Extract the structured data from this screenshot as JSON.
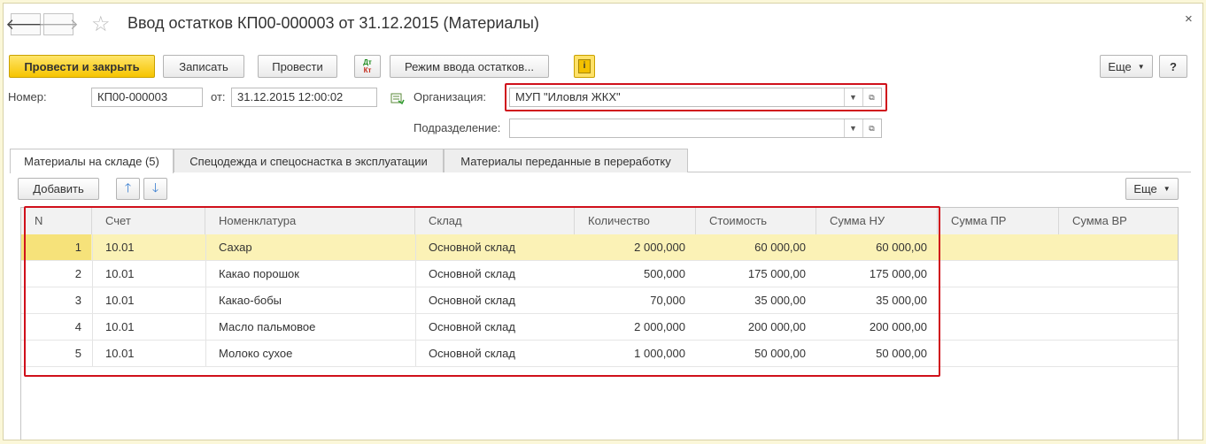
{
  "window": {
    "title": "Ввод остатков КП00-000003 от 31.12.2015 (Материалы)",
    "back_glyph": "🡐",
    "forward_glyph": "🡒",
    "close_glyph": "×",
    "star_glyph": "☆"
  },
  "toolbar": {
    "post_close": "Провести и закрыть",
    "save": "Записать",
    "post": "Провести",
    "dt_label": "Дт",
    "kt_label": "Кт",
    "mode": "Режим ввода остатков...",
    "info_glyph": "i",
    "more": "Еще",
    "help": "?"
  },
  "form": {
    "number_label": "Номер:",
    "number_value": "КП00-000003",
    "date_label": "от:",
    "date_value": "31.12.2015 12:00:02",
    "org_label": "Организация:",
    "org_value": "МУП \"Иловля ЖКХ\"",
    "dept_label": "Подразделение:",
    "dept_value": ""
  },
  "tabs": [
    {
      "label": "Материалы на складе (5)",
      "active": true
    },
    {
      "label": "Спецодежда и спецоснастка в эксплуатации",
      "active": false
    },
    {
      "label": "Материалы переданные в переработку",
      "active": false
    }
  ],
  "table_toolbar": {
    "add": "Добавить",
    "up_glyph": "🡑",
    "down_glyph": "🡓",
    "more": "Еще"
  },
  "table": {
    "columns": [
      "N",
      "Счет",
      "Номенклатура",
      "Склад",
      "Количество",
      "Стоимость",
      "Сумма НУ",
      "Сумма ПР",
      "Сумма ВР"
    ],
    "rows": [
      {
        "n": "1",
        "account": "10.01",
        "item": "Сахар",
        "warehouse": "Основной склад",
        "qty": "2 000,000",
        "cost": "60 000,00",
        "sum_nu": "60 000,00",
        "sum_pr": "",
        "sum_vr": ""
      },
      {
        "n": "2",
        "account": "10.01",
        "item": "Какао порошок",
        "warehouse": "Основной склад",
        "qty": "500,000",
        "cost": "175 000,00",
        "sum_nu": "175 000,00",
        "sum_pr": "",
        "sum_vr": ""
      },
      {
        "n": "3",
        "account": "10.01",
        "item": "Какао-бобы",
        "warehouse": "Основной склад",
        "qty": "70,000",
        "cost": "35 000,00",
        "sum_nu": "35 000,00",
        "sum_pr": "",
        "sum_vr": ""
      },
      {
        "n": "4",
        "account": "10.01",
        "item": "Масло пальмовое",
        "warehouse": "Основной склад",
        "qty": "2 000,000",
        "cost": "200 000,00",
        "sum_nu": "200 000,00",
        "sum_pr": "",
        "sum_vr": ""
      },
      {
        "n": "5",
        "account": "10.01",
        "item": "Молоко сухое",
        "warehouse": "Основной склад",
        "qty": "1 000,000",
        "cost": "50 000,00",
        "sum_nu": "50 000,00",
        "sum_pr": "",
        "sum_vr": ""
      }
    ],
    "selected_row": 0
  },
  "colors": {
    "accent_yellow": "#f6c400",
    "highlight_red": "#d0101b",
    "selected_row": "#fbf2b6"
  }
}
